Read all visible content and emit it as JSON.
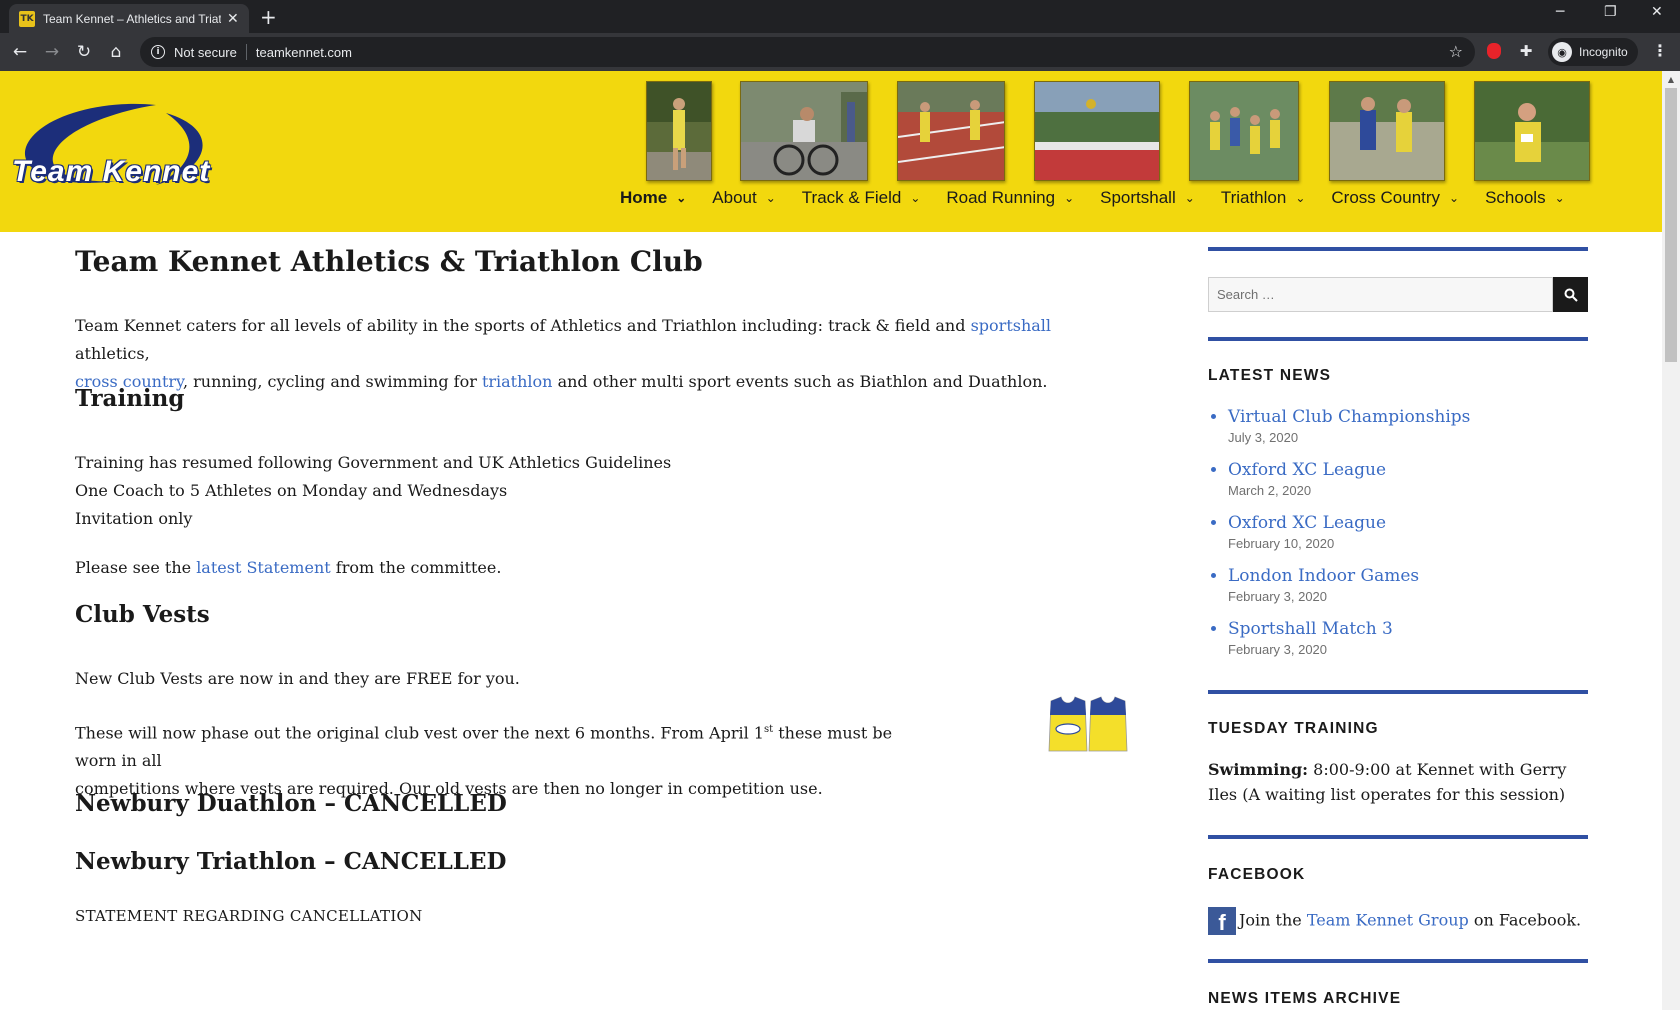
{
  "browser": {
    "tab_title": "Team Kennet – Athletics and Triat",
    "favicon_text": "TK",
    "new_tab": "+",
    "security_label": "Not secure",
    "url": "teamkennet.com",
    "profile_label": "Incognito"
  },
  "header": {
    "logo_text": "Team Kennet",
    "nav": [
      {
        "label": "Home",
        "active": true
      },
      {
        "label": "About"
      },
      {
        "label": "Track & Field"
      },
      {
        "label": "Road Running"
      },
      {
        "label": "Sportshall"
      },
      {
        "label": "Triathlon"
      },
      {
        "label": "Cross Country"
      },
      {
        "label": "Schools"
      }
    ]
  },
  "main": {
    "title": "Team Kennet Athletics & Triathlon Club",
    "intro": {
      "p1": "Team Kennet caters for all levels of ability in the sports of Athletics and Triathlon including: track & field and",
      "link_sportshall": "sportshall",
      "p2": "athletics,",
      "link_cross_country": "cross country",
      "p3": ", running, cycling and swimming for",
      "link_triathlon": "triathlon",
      "p4": "and other multi sport events such as Biathlon and Duathlon."
    },
    "training": {
      "heading": "Training",
      "line1": "Training has resumed following Government and UK Athletics Guidelines",
      "line2": "One Coach to 5 Athletes on Monday and Wednesdays",
      "line3": "Invitation only",
      "see_pre": "Please see the",
      "see_link": "latest Statement",
      "see_post": "from the committee."
    },
    "vests": {
      "heading": "Club Vests",
      "p1": "New Club Vests are now in and they are FREE for you.",
      "p2_pre": "These will now phase out the original club vest over the next 6 months. From April 1",
      "p2_sup": "st",
      "p2_post": "these must be worn in all",
      "p2_line2": "competitions where vests are required. Our old vests are then no longer in competition use."
    },
    "duathlon_heading": "Newbury Duathlon – CANCELLED",
    "triathlon_heading": "Newbury Triathlon – CANCELLED",
    "statement_heading": "STATEMENT REGARDING CANCELLATION"
  },
  "sidebar": {
    "search_placeholder": "Search …",
    "latest_news_title": "LATEST NEWS",
    "news": [
      {
        "title": "Virtual Club Championships",
        "date": "July 3, 2020"
      },
      {
        "title": "Oxford XC League",
        "date": "March 2, 2020"
      },
      {
        "title": "Oxford XC League",
        "date": "February 10, 2020"
      },
      {
        "title": "London Indoor Games",
        "date": "February 3, 2020"
      },
      {
        "title": "Sportshall Match 3",
        "date": "February 3, 2020"
      }
    ],
    "tuesday_title": "TUESDAY TRAINING",
    "tuesday_label": "Swimming:",
    "tuesday_text": "8:00-9:00 at Kennet with Gerry",
    "tuesday_text2": "Iles (A waiting list operates for this session)",
    "facebook_title": "FACEBOOK",
    "facebook_pre": "Join the",
    "facebook_link": "Team Kennet Group",
    "facebook_post": "on Facebook.",
    "archive_title": "NEWS ITEMS ARCHIVE"
  }
}
